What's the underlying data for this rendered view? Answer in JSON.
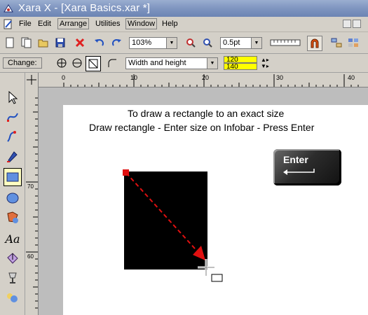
{
  "window": {
    "title": "Xara X - [Xara Basics.xar *]"
  },
  "menu": {
    "items": [
      "File",
      "Edit",
      "Arrange",
      "Utilities",
      "Window",
      "Help"
    ]
  },
  "toolbar": {
    "zoom": "103%",
    "line_width": "0.5pt"
  },
  "infobar": {
    "change_label": "Change:",
    "scale_mode": "Width and height",
    "width_value": "120",
    "height_value": "140"
  },
  "ruler": {
    "top_labels": [
      "0",
      "10",
      "20",
      "30",
      "40"
    ],
    "left_labels": [
      "70",
      "60"
    ]
  },
  "canvas": {
    "instruction_line1": "To draw a rectangle to an exact size",
    "instruction_line2": "Draw rectangle - Enter size on Infobar - Press Enter",
    "key_label": "Enter"
  },
  "colors": {
    "highlight_fields": "#ffff00",
    "arrow": "#e01010",
    "handle": "#e01010",
    "shape": "#000000"
  }
}
